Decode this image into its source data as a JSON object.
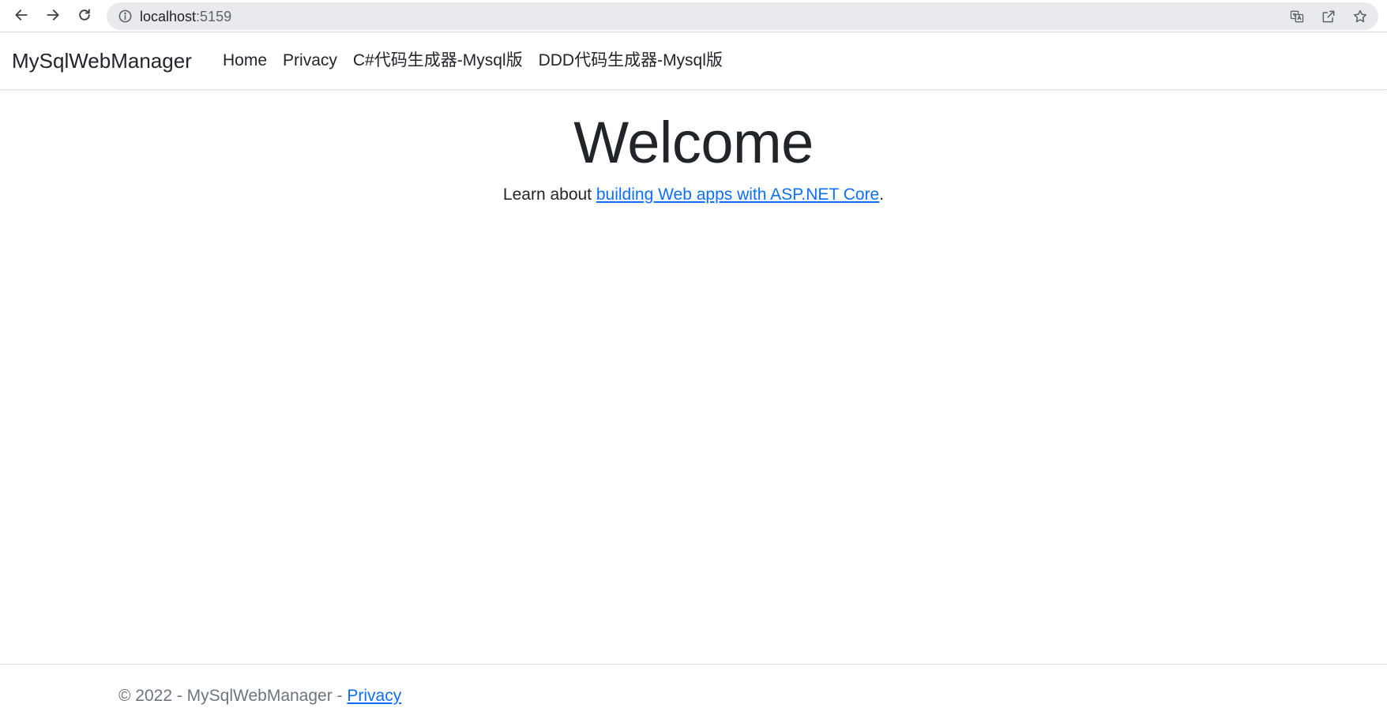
{
  "browser": {
    "url_host": "localhost",
    "url_port": ":5159",
    "icons": [
      "back-icon",
      "forward-icon",
      "reload-icon",
      "info-icon",
      "translate-icon",
      "share-icon",
      "bookmark-star-icon"
    ]
  },
  "navbar": {
    "brand": "MySqlWebManager",
    "links": [
      {
        "label": "Home"
      },
      {
        "label": "Privacy"
      },
      {
        "label": "C#代码生成器-Mysql版"
      },
      {
        "label": "DDD代码生成器-Mysql版"
      }
    ]
  },
  "main": {
    "title": "Welcome",
    "lead_prefix": "Learn about ",
    "lead_link": "building Web apps with ASP.NET Core",
    "lead_suffix": "."
  },
  "footer": {
    "text": "© 2022 - MySqlWebManager - ",
    "privacy_link": "Privacy"
  },
  "colors": {
    "link": "#0d6efd",
    "text": "#212529",
    "muted": "#6c757d",
    "omnibox": "#e8eaed"
  }
}
